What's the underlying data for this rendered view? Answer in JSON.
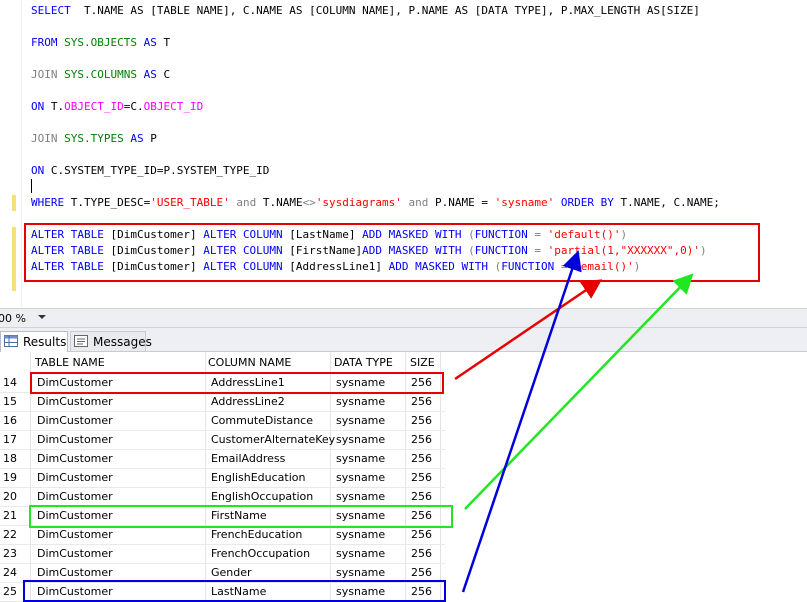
{
  "editor": {
    "query": {
      "l1_select": "SELECT",
      "l1_rest": "  T.NAME AS [TABLE NAME], C.NAME AS [COLUMN NAME], P.NAME AS [DATA TYPE], P.MAX_LENGTH AS[SIZE]",
      "l2_from": "FROM",
      "l2_obj": "SYS.OBJECTS",
      "l2_as": "AS",
      "l2_alias": " T",
      "l3_join": "JOIN",
      "l3_obj": "SYS.COLUMNS",
      "l3_as": "AS",
      "l3_alias": " C",
      "l4_on": "ON",
      "l4_a": " T.",
      "l4_fn1": "OBJECT_ID",
      "l4_b": "=C.",
      "l4_fn2": "OBJECT_ID",
      "l5_join": "JOIN",
      "l5_obj": "SYS.TYPES",
      "l5_as": "AS",
      "l5_alias": " P",
      "l6_on": "ON",
      "l6_rest": " C.SYSTEM_TYPE_ID=P.SYSTEM_TYPE_ID",
      "l7_where": "WHERE",
      "l7_a": " T.TYPE_DESC=",
      "l7_s1": "'USER_TABLE'",
      "l7_and1": "and",
      "l7_b": " T.NAME",
      "l7_op": "<>",
      "l7_s2": "'sysdiagrams'",
      "l7_and2": "and",
      "l7_c": " P.NAME = ",
      "l7_s3": "'sysname'",
      "l7_order": "ORDER BY",
      "l7_d": " T.NAME, C.NAME;"
    },
    "alters": [
      {
        "alter": "ALTER TABLE",
        "tbl": " [DimCustomer] ",
        "alter_col": "ALTER COLUMN",
        "col": " [LastName] ",
        "add_masked": "ADD MASKED WITH",
        "paren_open": " (",
        "function_kw": "FUNCTION",
        "eq": " = ",
        "value": "'default()'",
        "paren_close": ")"
      },
      {
        "alter": "ALTER TABLE",
        "tbl": " [DimCustomer] ",
        "alter_col": "ALTER COLUMN",
        "col": " [FirstName]",
        "add_masked": "ADD MASKED WITH",
        "paren_open": " (",
        "function_kw": "FUNCTION",
        "eq": " = ",
        "value": "'partial(1,\"XXXXXX\",0)'",
        "paren_close": ")"
      },
      {
        "alter": "ALTER TABLE",
        "tbl": " [DimCustomer] ",
        "alter_col": "ALTER COLUMN",
        "col": " [AddressLine1] ",
        "add_masked": "ADD MASKED WITH",
        "paren_open": " (",
        "function_kw": "FUNCTION",
        "eq": " = ",
        "value": "'email()'",
        "paren_close": ")"
      }
    ]
  },
  "status": {
    "zoom": "00 %"
  },
  "tabs": [
    {
      "label": "Results"
    },
    {
      "label": "Messages"
    }
  ],
  "grid": {
    "columns": [
      "TABLE NAME",
      "COLUMN NAME",
      "DATA TYPE",
      "SIZE"
    ],
    "rows": [
      {
        "num": "14",
        "table": "DimCustomer",
        "column": "AddressLine1",
        "type": "sysname",
        "size": "256"
      },
      {
        "num": "15",
        "table": "DimCustomer",
        "column": "AddressLine2",
        "type": "sysname",
        "size": "256"
      },
      {
        "num": "16",
        "table": "DimCustomer",
        "column": "CommuteDistance",
        "type": "sysname",
        "size": "256"
      },
      {
        "num": "17",
        "table": "DimCustomer",
        "column": "CustomerAlternateKey",
        "type": "sysname",
        "size": "256"
      },
      {
        "num": "18",
        "table": "DimCustomer",
        "column": "EmailAddress",
        "type": "sysname",
        "size": "256"
      },
      {
        "num": "19",
        "table": "DimCustomer",
        "column": "EnglishEducation",
        "type": "sysname",
        "size": "256"
      },
      {
        "num": "20",
        "table": "DimCustomer",
        "column": "EnglishOccupation",
        "type": "sysname",
        "size": "256"
      },
      {
        "num": "21",
        "table": "DimCustomer",
        "column": "FirstName",
        "type": "sysname",
        "size": "256"
      },
      {
        "num": "22",
        "table": "DimCustomer",
        "column": "FrenchEducation",
        "type": "sysname",
        "size": "256"
      },
      {
        "num": "23",
        "table": "DimCustomer",
        "column": "FrenchOccupation",
        "type": "sysname",
        "size": "256"
      },
      {
        "num": "24",
        "table": "DimCustomer",
        "column": "Gender",
        "type": "sysname",
        "size": "256"
      },
      {
        "num": "25",
        "table": "DimCustomer",
        "column": "LastName",
        "type": "sysname",
        "size": "256"
      }
    ]
  },
  "colors": {
    "keyword": "#0000ff",
    "function": "#ff00ff",
    "string": "#ff0000",
    "annotation_red": "#e60000",
    "annotation_green": "#22e622",
    "annotation_blue": "#0000dd"
  }
}
